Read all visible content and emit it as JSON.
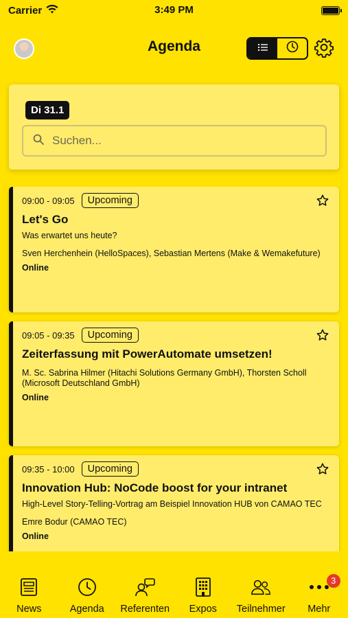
{
  "status_bar": {
    "carrier": "Carrier",
    "time": "3:49 PM"
  },
  "header": {
    "title": "Agenda"
  },
  "filter": {
    "date_label": "Di 31.1",
    "search_placeholder": "Suchen..."
  },
  "events": [
    {
      "time": "09:00 - 09:05",
      "status": "Upcoming",
      "title": "Let's Go",
      "description": "Was erwartet uns heute?",
      "speakers": "Sven Herchenhein (HelloSpaces), Sebastian Mertens (Make & Wemakefuture)",
      "location": "Online"
    },
    {
      "time": "09:05 - 09:35",
      "status": "Upcoming",
      "title": "Zeiterfassung mit PowerAutomate umsetzen!",
      "description": "",
      "speakers": "M. Sc. Sabrina Hilmer (Hitachi Solutions Germany GmbH), Thorsten Scholl (Microsoft Deutschland GmbH)",
      "location": "Online"
    },
    {
      "time": "09:35 - 10:00",
      "status": "Upcoming",
      "title": "Innovation Hub: NoCode boost for your intranet",
      "description": "High-Level Story-Telling-Vortrag am Beispiel Innovation HUB von CAMAO TEC",
      "speakers": "Emre Bodur (CAMAO TEC)",
      "location": "Online"
    }
  ],
  "tabbar": {
    "items": [
      {
        "label": "News",
        "icon": "newspaper-icon"
      },
      {
        "label": "Agenda",
        "icon": "clock-icon"
      },
      {
        "label": "Referenten",
        "icon": "speakers-icon"
      },
      {
        "label": "Expos",
        "icon": "building-icon"
      },
      {
        "label": "Teilnehmer",
        "icon": "people-icon"
      },
      {
        "label": "Mehr",
        "icon": "more-icon",
        "badge": "3"
      }
    ]
  },
  "colors": {
    "background": "#FFE200",
    "card": "#FFEC6B",
    "badge": "#E53A2B",
    "dark": "#111111"
  }
}
